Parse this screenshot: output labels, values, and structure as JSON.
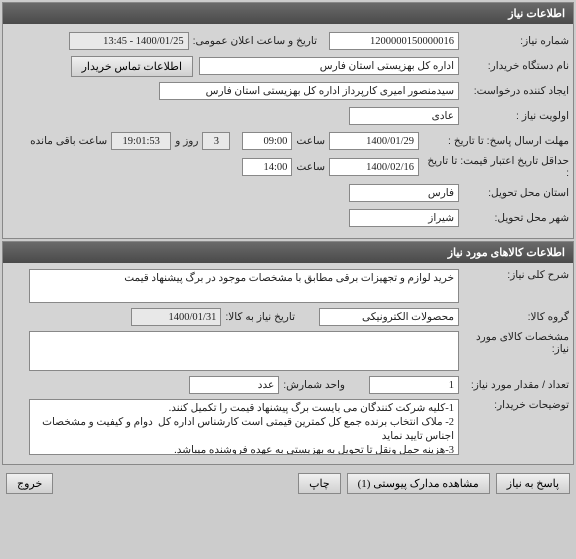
{
  "panel1": {
    "title": "اطلاعات نیاز",
    "need_no_label": "شماره نیاز:",
    "need_no": "1200000150000016",
    "announce_label": "تاریخ و ساعت اعلان عمومی:",
    "announce_value": "1400/01/25 - 13:45",
    "buyer_label": "نام دستگاه خریدار:",
    "buyer_value": "اداره کل بهزیستی استان فارس",
    "contact_btn": "اطلاعات تماس خریدار",
    "creator_label": "ایجاد کننده درخواست:",
    "creator_value": "سیدمنصور امیری کارپرداز اداره کل بهزیستی استان فارس",
    "priority_label": "اولویت نیاز :",
    "priority_value": "عادی",
    "deadline_label": "مهلت ارسال پاسخ:",
    "deadline_to_label": "تا تاریخ :",
    "deadline_date": "1400/01/29",
    "time_label": "ساعت",
    "deadline_time": "09:00",
    "days_value": "3",
    "days_label": "روز و",
    "countdown": "19:01:53",
    "remaining_label": "ساعت باقی مانده",
    "min_validity_label": "حداقل تاریخ اعتبار قیمت:",
    "min_validity_to": "تا تاریخ :",
    "min_validity_date": "1400/02/16",
    "min_validity_time": "14:00",
    "province_label": "استان محل تحویل:",
    "province_value": "فارس",
    "city_label": "شهر محل تحویل:",
    "city_value": "شیراز"
  },
  "panel2": {
    "title": "اطلاعات کالاهای مورد نیاز",
    "desc_label": "شرح کلی نیاز:",
    "desc_value": "خرید لوازم و تجهیزات برقی مطابق با مشخصات موجود در برگ پیشنهاد قیمت",
    "group_label": "گروه کالا:",
    "group_value": "محصولات الکترونیکی",
    "need_date_label": "تاریخ نیاز به کالا:",
    "need_date_value": "1400/01/31",
    "spec_label": "مشخصات کالای مورد نیاز:",
    "spec_value": "",
    "qty_label": "تعداد / مقدار مورد نیاز:",
    "qty_value": "1",
    "unit_label": "واحد شمارش:",
    "unit_value": "عدد",
    "notes_label": "توضیحات خریدار:",
    "notes_value": "1-کلیه شرکت کنندگان می بایست برگ پیشنهاد قیمت را تکمیل کنند.\n2- ملاک انتخاب برنده جمع کل کمترین قیمتی است کارشناس اداره کل  دوام و کیفیت و مشخصات اجناس تایید نماید\n3-هزینه حمل ونقل تا تحویل به بهزیستی به عهده فروشنده میباشد."
  },
  "buttons": {
    "respond": "پاسخ به نیاز",
    "attachments": "مشاهده مدارک پیوستی (1)",
    "print": "چاپ",
    "exit": "خروج"
  }
}
